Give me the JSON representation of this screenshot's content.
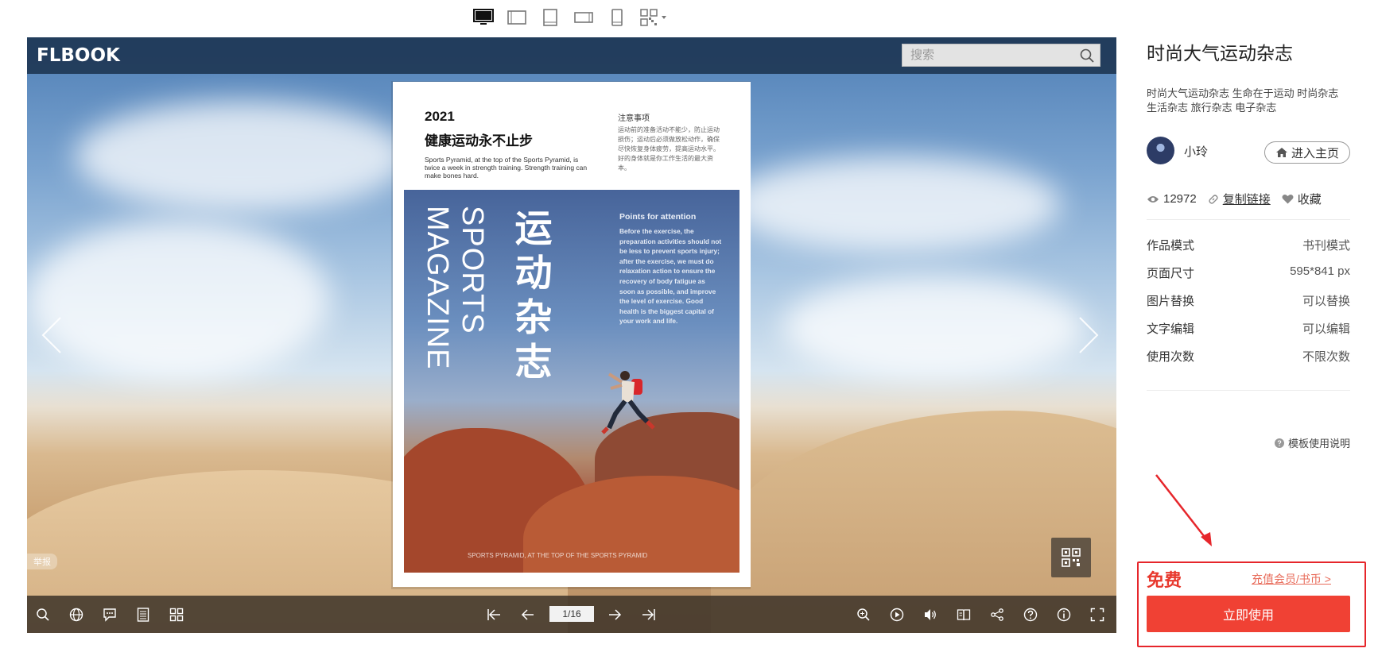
{
  "device_bar": {
    "items": [
      {
        "icon": "desktop-icon",
        "active": true
      },
      {
        "icon": "tablet-landscape-icon"
      },
      {
        "icon": "tablet-portrait-icon"
      },
      {
        "icon": "phone-landscape-icon"
      },
      {
        "icon": "phone-portrait-icon"
      },
      {
        "icon": "qrcode-dropdown-icon"
      }
    ]
  },
  "viewer": {
    "logo": "FLBOOK",
    "search_placeholder": "搜索",
    "report_label": "举报",
    "page_indicator": "1/16",
    "book": {
      "year": "2021",
      "headline": "健康运动永不止步",
      "intro": "Sports Pyramid, at the top of the Sports Pyramid, is twice a week in strength training. Strength training can make bones hard.",
      "note_heading": "注意事项",
      "note_body": "运动前的准备活动不能少，防止运动损伤；运动后必须做放松动作，确保尽快恢复身体疲劳，提高运动水平。好的身体就是你工作生活的最大资本。",
      "cover_title_cn": [
        "运",
        "动",
        "杂",
        "志"
      ],
      "cover_title_en_1": "SPORTS",
      "cover_title_en_2": "MAGAZINE",
      "points_heading": "Points for attention",
      "points_body": "Before the exercise, the preparation activities should not be less to prevent sports injury; after the exercise, we must do relaxation action to ensure the recovery of body fatigue as soon as possible, and improve the level of exercise. Good health is the biggest capital of your work and life.",
      "cover_footer": "SPORTS PYRAMID, AT THE TOP OF THE SPORTS PYRAMID"
    },
    "toolbar_left": [
      "search-icon",
      "language-icon",
      "comment-icon",
      "toc-icon",
      "thumbnails-icon"
    ],
    "toolbar_nav": [
      "first-page-icon",
      "prev-page-icon",
      "next-page-icon",
      "last-page-icon"
    ],
    "toolbar_right": [
      "zoom-in-icon",
      "autoplay-icon",
      "sound-icon",
      "bookmark-icon",
      "share-icon",
      "help-icon",
      "info-icon",
      "fullscreen-icon"
    ]
  },
  "panel": {
    "title": "时尚大气运动杂志",
    "tags": "时尚大气运动杂志 生命在于运动 时尚杂志 生活杂志 旅行杂志 电子杂志",
    "author": "小玲",
    "home_button": "进入主页",
    "views": "12972",
    "copy_link": "复制链接",
    "favorite": "收藏",
    "specs": [
      {
        "label": "作品模式",
        "value": "书刊模式"
      },
      {
        "label": "页面尺寸",
        "value": "595*841 px"
      },
      {
        "label": "图片替换",
        "value": "可以替换"
      },
      {
        "label": "文字编辑",
        "value": "可以编辑"
      },
      {
        "label": "使用次数",
        "value": "不限次数"
      }
    ],
    "help_text": "模板使用说明",
    "price": "免费",
    "recharge": "充值会员/书币 >",
    "use_button": "立即使用"
  },
  "colors": {
    "accent_red": "#f04134",
    "highlight_border": "#e6262b",
    "viewer_topbar": "#1e3755"
  }
}
